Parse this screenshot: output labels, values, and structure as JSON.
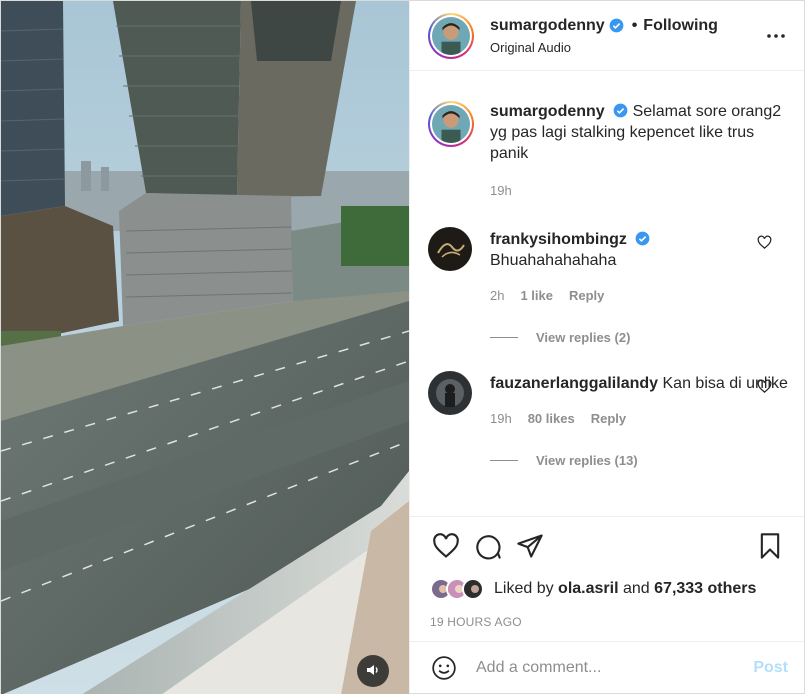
{
  "colors": {
    "accent": "#0095f6",
    "verified": "#3897f0",
    "muted": "#8e8e8e",
    "text": "#262626"
  },
  "post": {
    "media_sound_icon": "speaker-icon",
    "header": {
      "username": "sumargodenny",
      "separator": "•",
      "follow_state": "Following",
      "audio": "Original Audio"
    },
    "caption": {
      "username": "sumargodenny",
      "text": "Selamat sore orang2 yg pas lagi stalking kepencet like trus panik",
      "time": "19h"
    },
    "comments": [
      {
        "username": "frankysihombingz",
        "verified": true,
        "text": "Bhuahahahahaha",
        "time": "2h",
        "likes": "1 like",
        "reply": "Reply",
        "view_replies": "View replies (2)"
      },
      {
        "username": "fauzanerlanggalilandy",
        "verified": false,
        "text": "Kan bisa di unlike",
        "time": "19h",
        "likes": "80 likes",
        "reply": "Reply",
        "view_replies": "View replies (13)"
      }
    ],
    "likes": {
      "prefix": "Liked by",
      "user": "ola.asril",
      "joiner": "and",
      "others": "67,333 others"
    },
    "time_ago": "19 HOURS AGO",
    "comment_box": {
      "placeholder": "Add a comment...",
      "post_label": "Post"
    }
  }
}
